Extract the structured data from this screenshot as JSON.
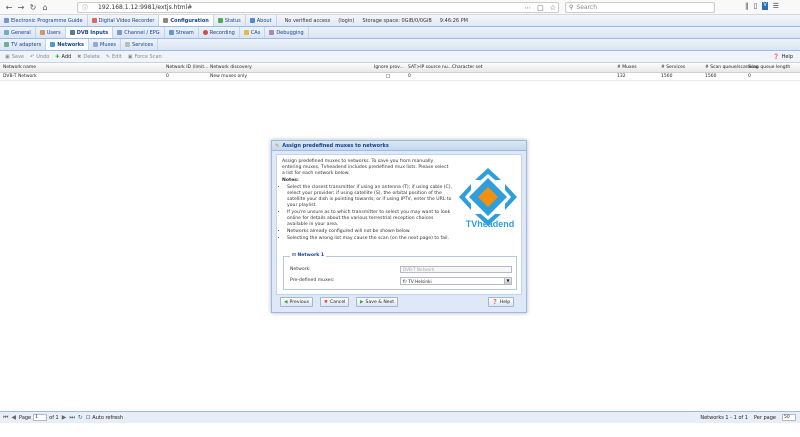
{
  "browser": {
    "url": "192.168.1.12:9981/extjs.html#",
    "search_placeholder": "Search"
  },
  "main_tabs": [
    {
      "label": "Electronic Programme Guide"
    },
    {
      "label": "Digital Video Recorder"
    },
    {
      "label": "Configuration"
    },
    {
      "label": "Status"
    },
    {
      "label": "About"
    }
  ],
  "status": {
    "verified": "No verified access",
    "user": "(login)",
    "storage": "Storage space: 0GiB/0/0GiB",
    "time": "9:46:26 PM"
  },
  "config_tabs": [
    {
      "label": "General"
    },
    {
      "label": "Users"
    },
    {
      "label": "DVB Inputs"
    },
    {
      "label": "Channel / EPG"
    },
    {
      "label": "Stream"
    },
    {
      "label": "Recording"
    },
    {
      "label": "CAs"
    },
    {
      "label": "Debugging"
    }
  ],
  "dvb_tabs": [
    {
      "label": "TV adapters"
    },
    {
      "label": "Networks"
    },
    {
      "label": "Muxes"
    },
    {
      "label": "Services"
    }
  ],
  "toolbar": {
    "save": "Save",
    "undo": "Undo",
    "add": "Add",
    "delete": "Delete",
    "edit": "Edit",
    "force_scan": "Force Scan",
    "help": "Help"
  },
  "grid": {
    "headers": [
      "Network name",
      "Network ID (limit...",
      "Network discovery",
      "Ignore prov...",
      "SAT>IP source nu...",
      "Character set",
      "# Muxes",
      "# Services",
      "# Scan queue/scanning",
      "Scan queue length"
    ],
    "row": [
      "DVB-T Network",
      "0",
      "New muxes only",
      "",
      "0",
      "",
      "132",
      "1560",
      "1560",
      "0"
    ]
  },
  "dialog": {
    "title": "Assign predefined muxes to networks",
    "intro": "Assign predefined muxes to networks. To save you from manually entering muxes, Tvheadend includes predefined mux lists. Please select a list for each network below.",
    "notes_label": "Notes:",
    "notes": [
      "Select the closest transmitter if using an antenna (T); if using cable (C), select your provider; if using satellite (S), the orbital position of the satellite your dish is pointing towards; or if using IPTV, enter the URL to your playlist.",
      "If you're unsure as to which transmitter to select you may want to look online for details about the various terrestrial reception choices available in your area.",
      "Networks already configured will not be shown below.",
      "Selecting the wrong list may cause the scan (on the next page) to fail."
    ],
    "logo_text": "TVheadend",
    "fieldset_legend": "Network 1",
    "network_label": "Network:",
    "network_value": "DVB-T Network",
    "muxes_label": "Pre-defined muxes:",
    "muxes_value": "fi: TV Helsinki",
    "buttons": {
      "previous": "Previous",
      "cancel": "Cancel",
      "save_next": "Save & Next",
      "help": "Help"
    }
  },
  "footer": {
    "page_label": "Page",
    "page_value": "1",
    "of_label": "of 1",
    "auto_refresh": "Auto refresh",
    "display_info": "Networks 1 - 1 of 1",
    "per_page_label": "Per page",
    "per_page_value": "50"
  },
  "colors": {
    "accent": "#15428b",
    "logo_blue": "#2f9fdb",
    "logo_orange": "#f29111"
  }
}
